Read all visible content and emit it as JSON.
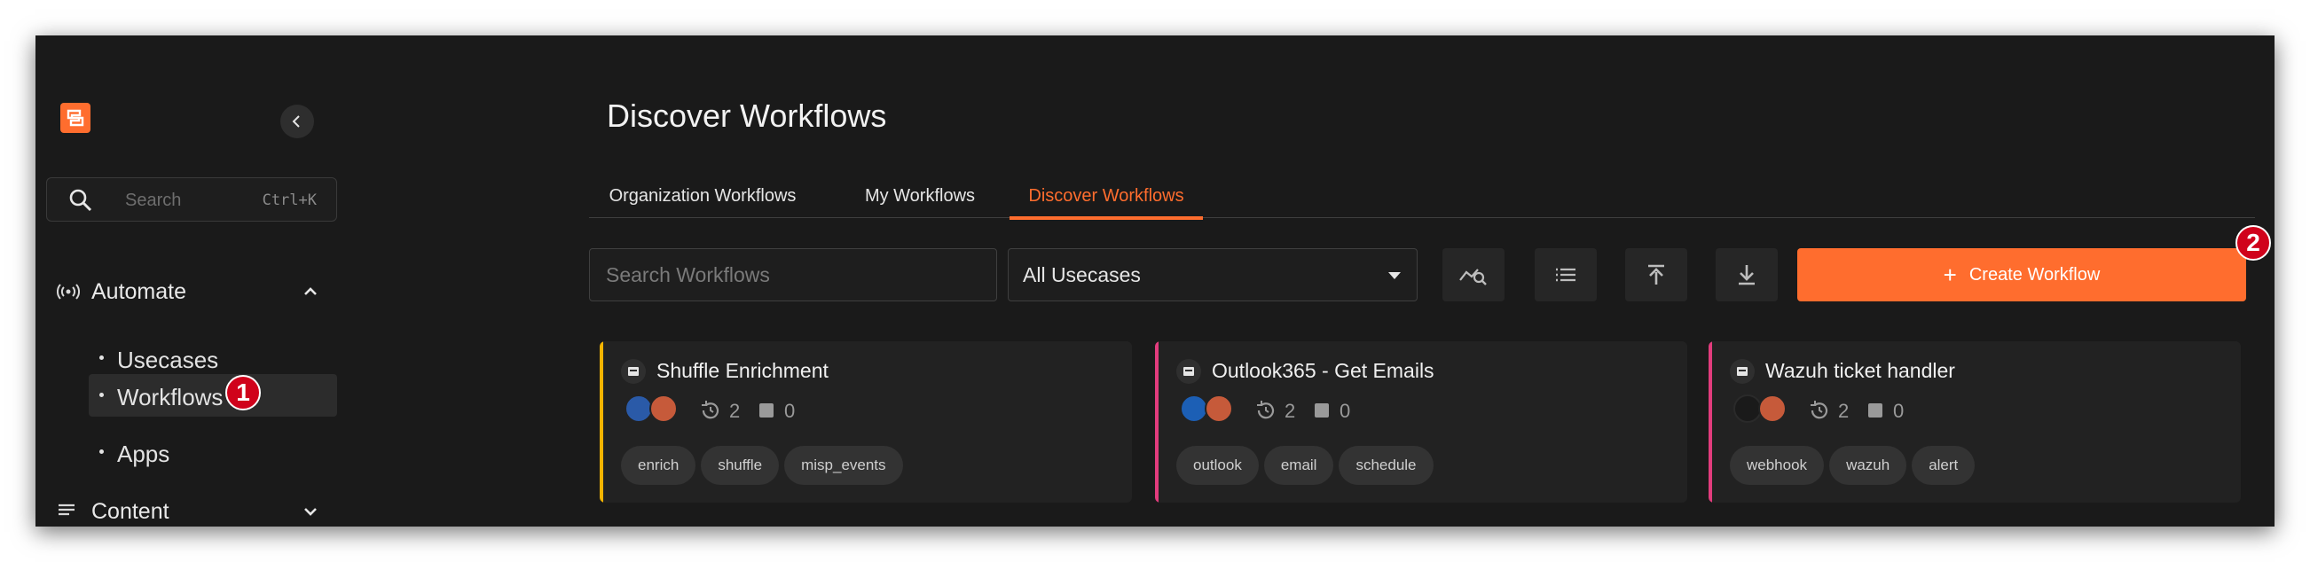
{
  "colors": {
    "accent": "#ff6d2e",
    "badge": "#d0021b",
    "card_yellow": "#f5b400",
    "card_pink": "#e23c7d"
  },
  "sidebar": {
    "search_placeholder": "Search",
    "search_shortcut": "Ctrl+K",
    "sections": [
      {
        "label": "Automate",
        "icon": "broadcast-icon",
        "expanded": true,
        "items": [
          {
            "label": "Usecases"
          },
          {
            "label": "Workflows",
            "active": true
          },
          {
            "label": "Apps"
          }
        ]
      },
      {
        "label": "Content",
        "icon": "list-icon",
        "expanded": false
      }
    ],
    "badge_1": "1"
  },
  "main": {
    "title": "Discover Workflows",
    "tabs": [
      {
        "label": "Organization Workflows"
      },
      {
        "label": "My Workflows"
      },
      {
        "label": "Discover Workflows",
        "active": true
      }
    ],
    "search_placeholder": "Search Workflows",
    "usecase_select": "All Usecases",
    "create_button": "Create Workflow",
    "badge_2": "2"
  },
  "cards": [
    {
      "title": "Shuffle Enrichment",
      "accent": "yellow",
      "runs": "2",
      "triggers": "0",
      "tags": [
        "enrich",
        "shuffle",
        "misp_events"
      ]
    },
    {
      "title": "Outlook365 - Get Emails",
      "accent": "pink",
      "runs": "2",
      "triggers": "0",
      "tags": [
        "outlook",
        "email",
        "schedule"
      ]
    },
    {
      "title": "Wazuh ticket handler",
      "accent": "pink",
      "runs": "2",
      "triggers": "0",
      "tags": [
        "webhook",
        "wazuh",
        "alert"
      ]
    }
  ]
}
